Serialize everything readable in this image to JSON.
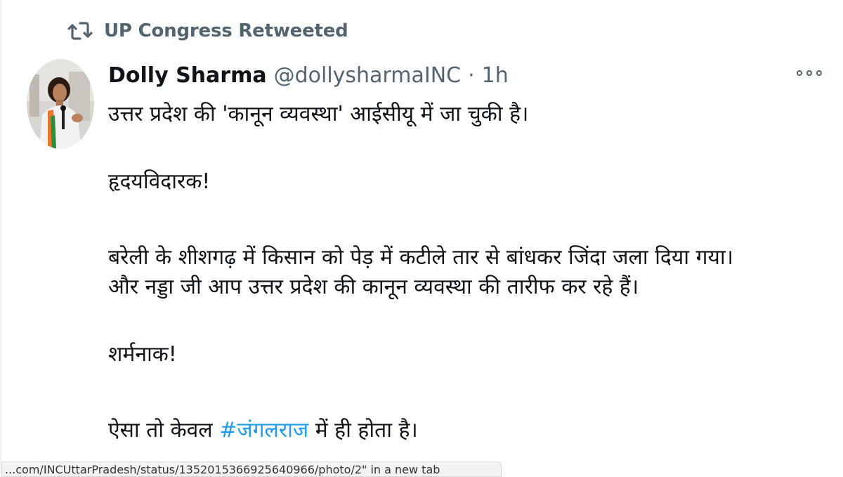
{
  "retweet": {
    "label": "UP Congress Retweeted",
    "icon": "retweet-icon"
  },
  "tweet": {
    "author_name": "Dolly Sharma",
    "handle": "@dollysharmaINC",
    "separator": "·",
    "time": "1h",
    "more_icon": "more-options-icon",
    "lines": [
      "उत्तर प्रदेश की 'कानून व्यवस्था' आईसीयू में जा चुकी है।",
      "हृदयविदारक!",
      "बरेली के शीशगढ़ में किसान को पेड़ में कटीले तार से बांधकर जिंदा जला दिया गया।",
      "और नड्डा जी आप उत्तर प्रदेश की कानून व्यवस्था की तारीफ कर रहे हैं।",
      "शर्मनाक!",
      "ऐसा तो केवल"
    ],
    "hashtag": "#जंगलराज",
    "last_line_suffix": "में ही होता है।"
  },
  "status_bar": {
    "text": "...com/INCUttarPradesh/status/1352015366925640966/photo/2\" in a new tab"
  },
  "colors": {
    "text": "#0f1419",
    "muted": "#536471",
    "link": "#1d9bf0"
  }
}
